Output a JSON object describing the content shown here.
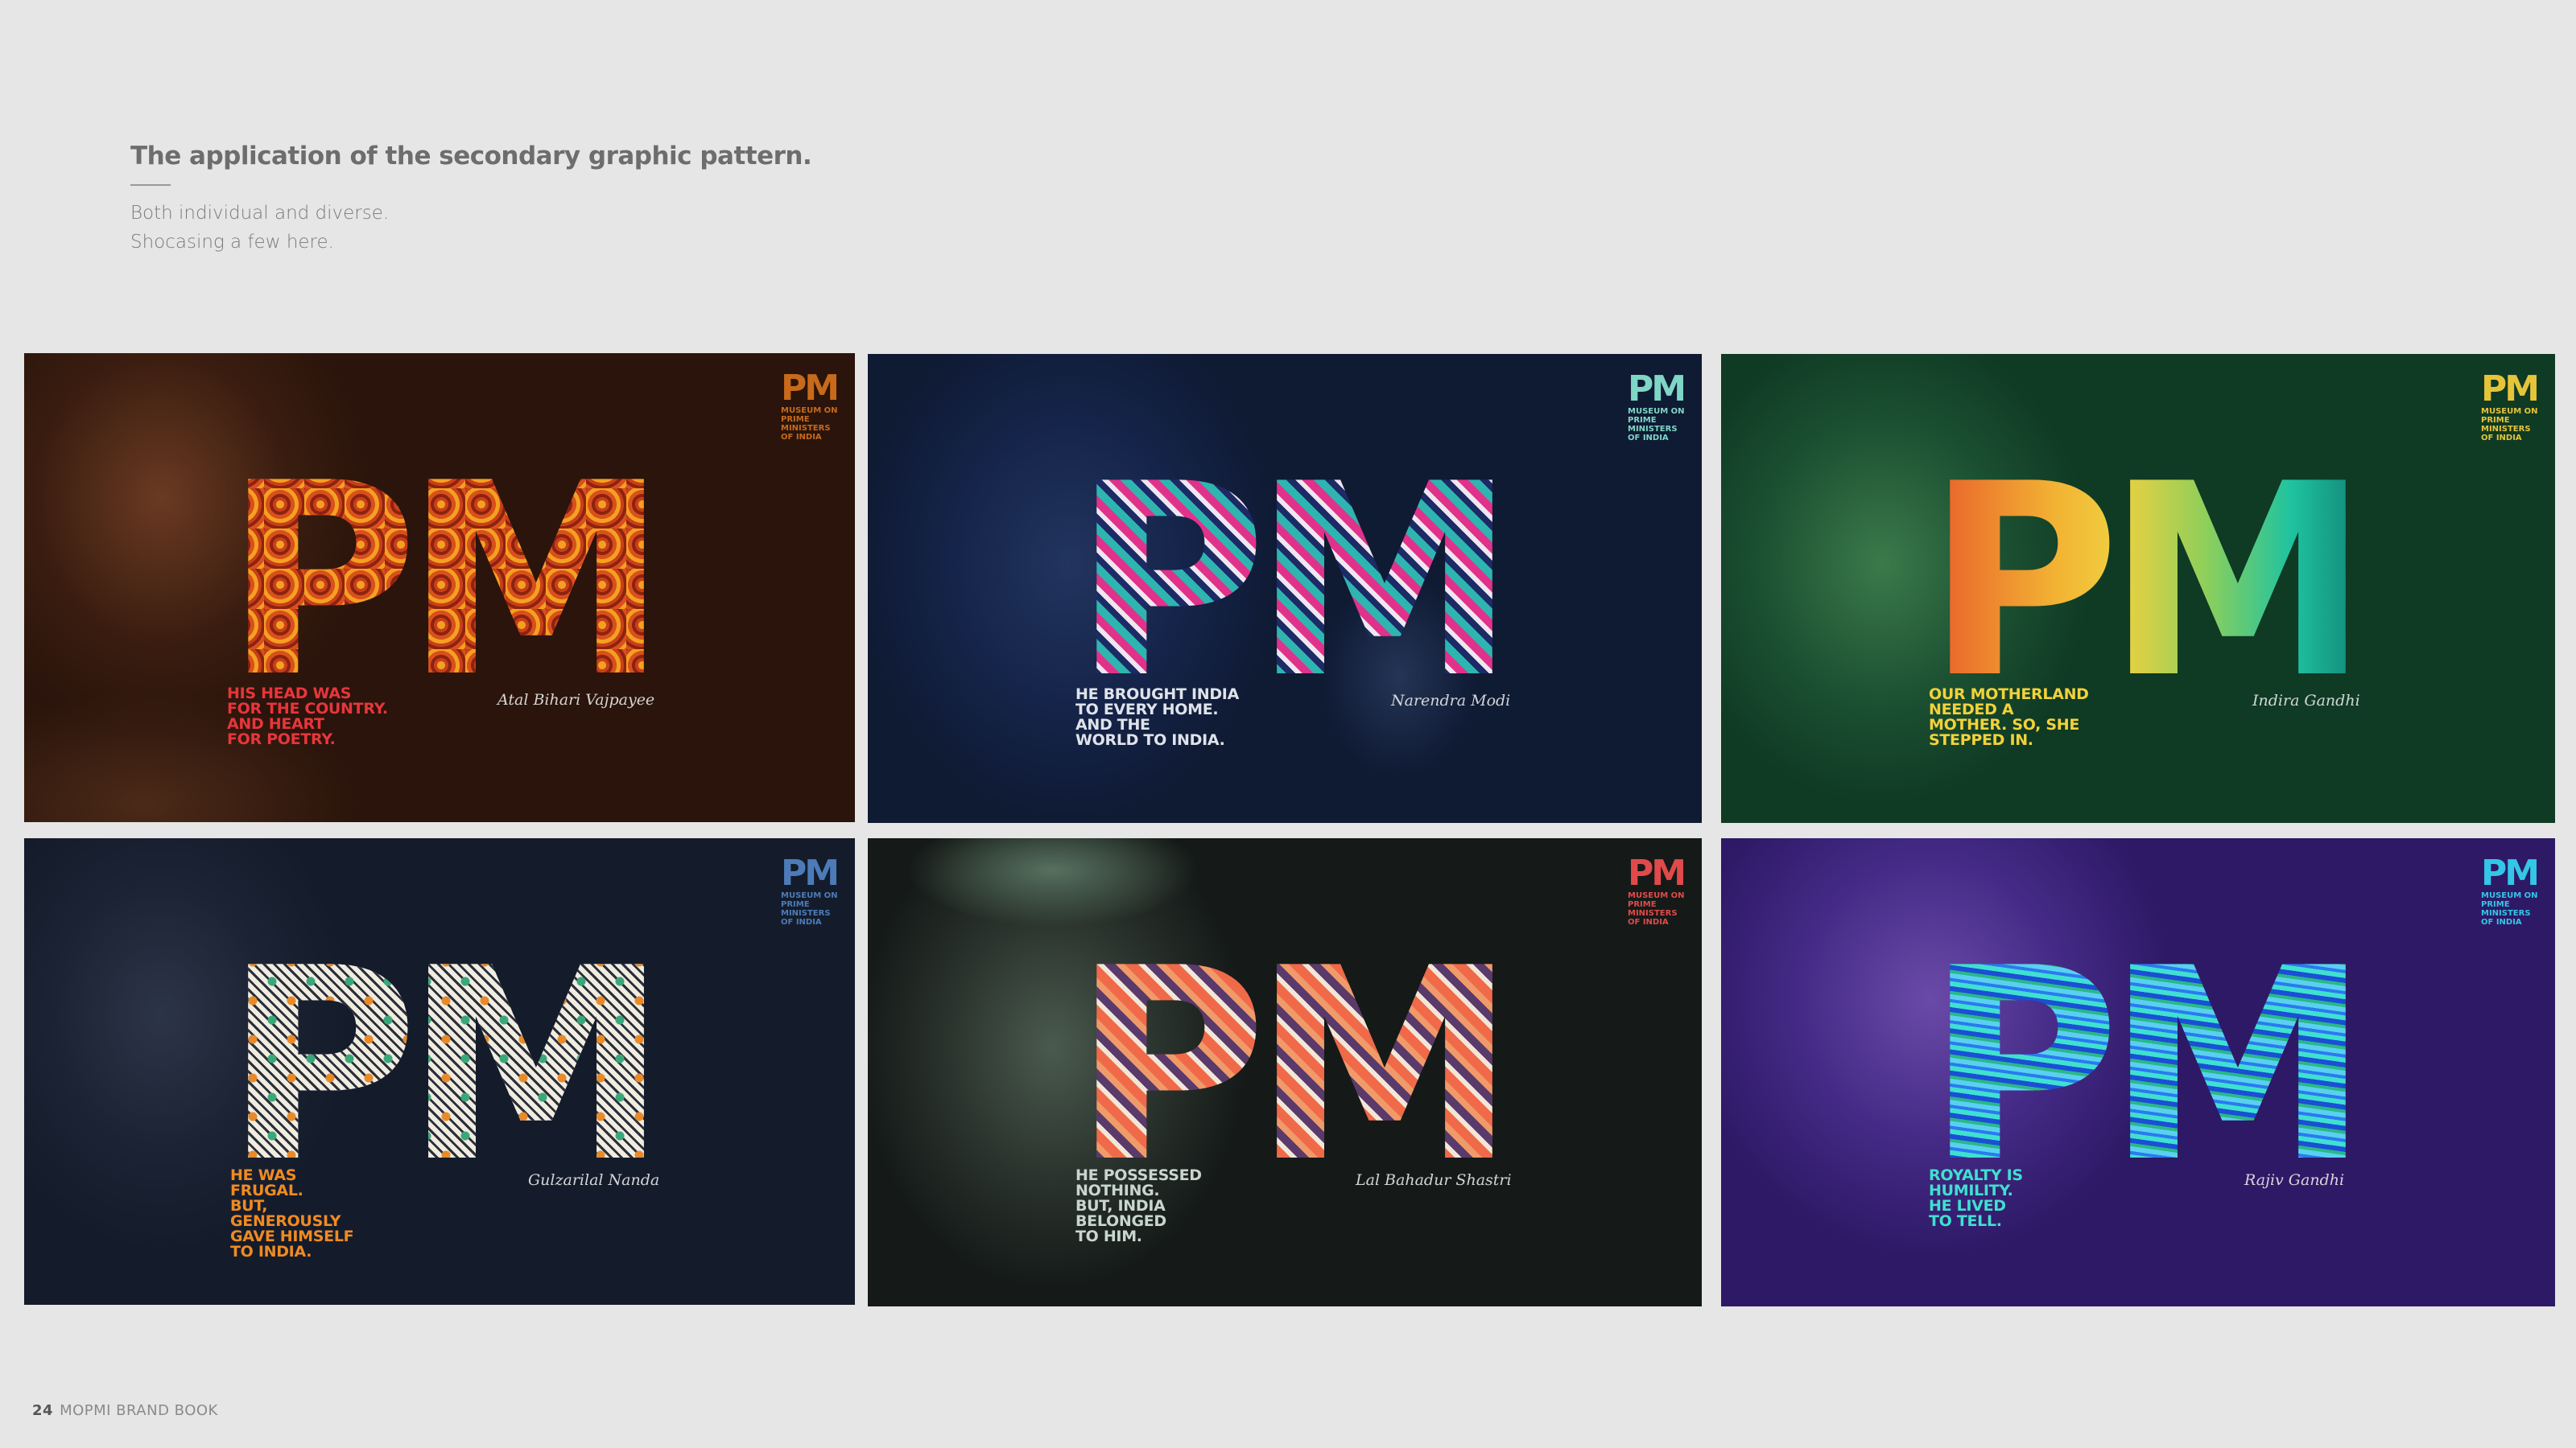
{
  "page": {
    "heading": "The application of the secondary graphic pattern.",
    "sub_line1": "Both individual and diverse.",
    "sub_line2": "Shocasing a few here.",
    "footer_number": "24",
    "footer_title": "MOPMI BRAND BOOK"
  },
  "logo": {
    "mark": "PM",
    "text": "MUSEUM ON\nPRIME\nMINISTERS\nOF INDIA"
  },
  "cards": [
    {
      "quote": "HIS HEAD WAS\nFOR THE COUNTRY.\nAND HEART\nFOR POETRY.",
      "signature": "Atal Bihari Vajpayee",
      "quote_color": "#e8353b",
      "bg": "#2a140b",
      "pattern": "orange-scallop",
      "logo_color": "#c76a1b"
    },
    {
      "quote": "HE BROUGHT INDIA\nTO EVERY HOME.\nAND THE\nWORLD TO INDIA.",
      "signature": "Narendra Modi",
      "quote_color": "#dfe3ea",
      "bg": "#0f1a33",
      "pattern": "pink-teal-chevron",
      "logo_color": "#7fd6c6"
    },
    {
      "quote": "OUR MOTHERLAND\nNEEDED A\nMOTHER. SO, SHE\nSTEPPED IN.",
      "signature": "Indira Gandhi",
      "quote_color": "#f2d23a",
      "bg": "#0f3a24",
      "pattern": "yellow-teal-triangles",
      "logo_color": "#e6c43a"
    },
    {
      "quote": "HE WAS\nFRUGAL.\nBUT,\nGENEROUSLY\nGAVE HIMSELF\nTO INDIA.",
      "signature": "Gulzarilal Nanda",
      "quote_color": "#f08a22",
      "bg": "#141c2b",
      "pattern": "lattice",
      "logo_color": "#4c7bb8"
    },
    {
      "quote": "HE POSSESSED\nNOTHING.\nBUT, INDIA\nBELONGED\nTO HIM.",
      "signature": "Lal Bahadur Shastri",
      "quote_color": "#c9d6cf",
      "bg": "#151a18",
      "pattern": "coral-diamonds",
      "logo_color": "#e04a4a"
    },
    {
      "quote": "ROYALTY IS\nHUMILITY.\nHE LIVED\nTO TELL.",
      "signature": "Rajiv Gandhi",
      "quote_color": "#3fe0d0",
      "bg": "#2e1966",
      "pattern": "blue-waves",
      "logo_color": "#33c6e6"
    }
  ]
}
